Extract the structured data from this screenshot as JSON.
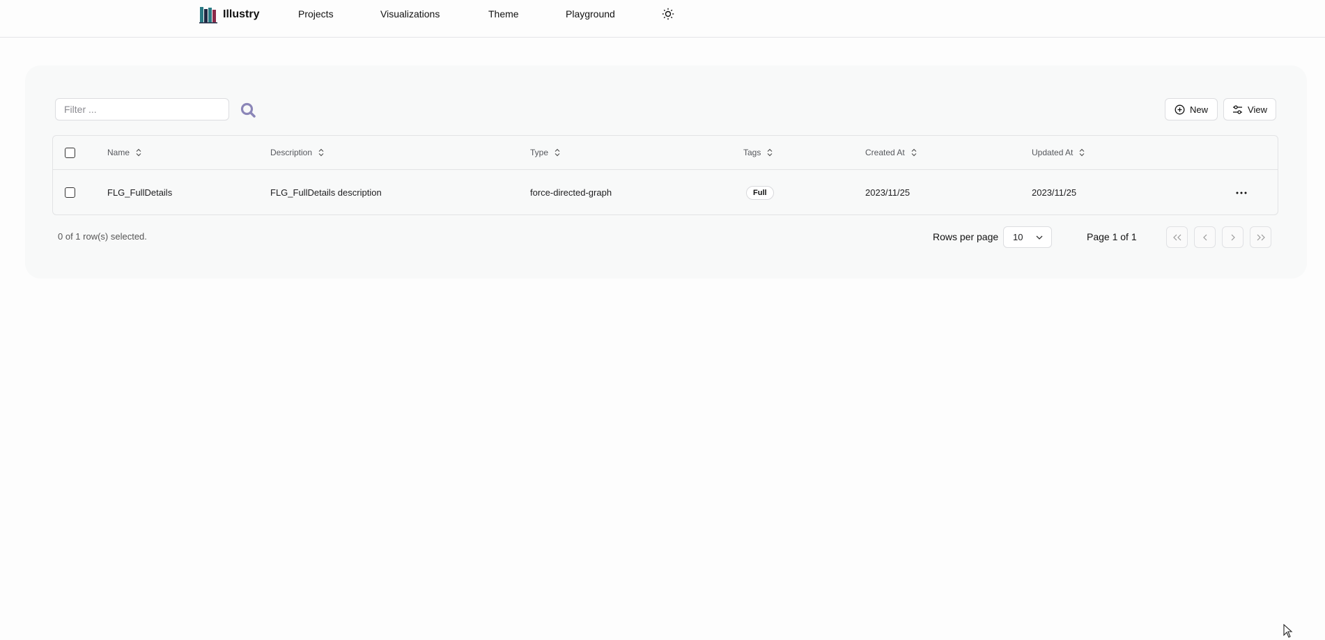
{
  "nav": {
    "brand": "Illustry",
    "links": [
      "Projects",
      "Visualizations",
      "Theme",
      "Playground"
    ]
  },
  "toolbar": {
    "filter_placeholder": "Filter ...",
    "filter_value": "",
    "new_label": "New",
    "view_label": "View"
  },
  "table": {
    "headers": {
      "name": "Name",
      "description": "Description",
      "type": "Type",
      "tags": "Tags",
      "created_at": "Created At",
      "updated_at": "Updated At"
    },
    "rows": [
      {
        "name": "FLG_FullDetails",
        "description": "FLG_FullDetails description",
        "type": "force-directed-graph",
        "tag": "Full",
        "created_at": "2023/11/25",
        "updated_at": "2023/11/25"
      }
    ]
  },
  "footer": {
    "selection_text": "0 of 1 row(s) selected.",
    "rows_per_page_label": "Rows per page",
    "rows_per_page_value": "10",
    "page_label": "Page 1 of 1"
  },
  "colors": {
    "logo_bars": [
      "#2a7a84",
      "#1f2a44",
      "#8a2a4a"
    ],
    "search_icon": "#8b86b8"
  }
}
